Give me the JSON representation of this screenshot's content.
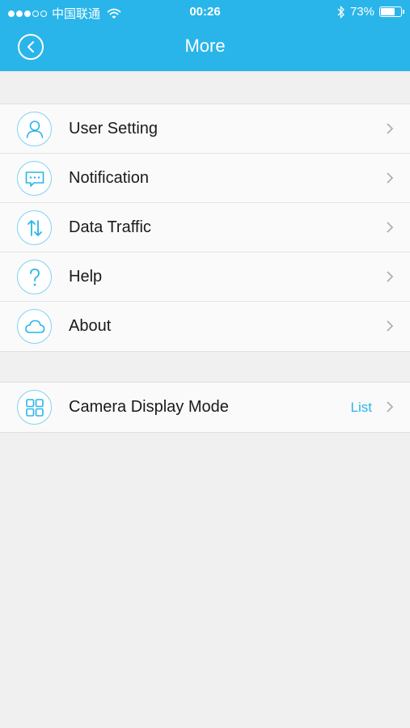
{
  "status_bar": {
    "carrier": "中国联通",
    "time": "00:26",
    "battery_percent": "73%",
    "battery_level": 0.73
  },
  "nav": {
    "title": "More",
    "back_icon": "chevron-left-circle-icon"
  },
  "menu": {
    "items": [
      {
        "label": "User Setting",
        "icon": "user-icon"
      },
      {
        "label": "Notification",
        "icon": "message-icon"
      },
      {
        "label": "Data Traffic",
        "icon": "up-down-arrows-icon"
      },
      {
        "label": "Help",
        "icon": "question-icon"
      },
      {
        "label": "About",
        "icon": "cloud-icon"
      }
    ]
  },
  "display": {
    "label": "Camera Display Mode",
    "value": "List",
    "icon": "grid-icon"
  },
  "colors": {
    "accent": "#29b5ea",
    "background": "#f0f0f0"
  }
}
